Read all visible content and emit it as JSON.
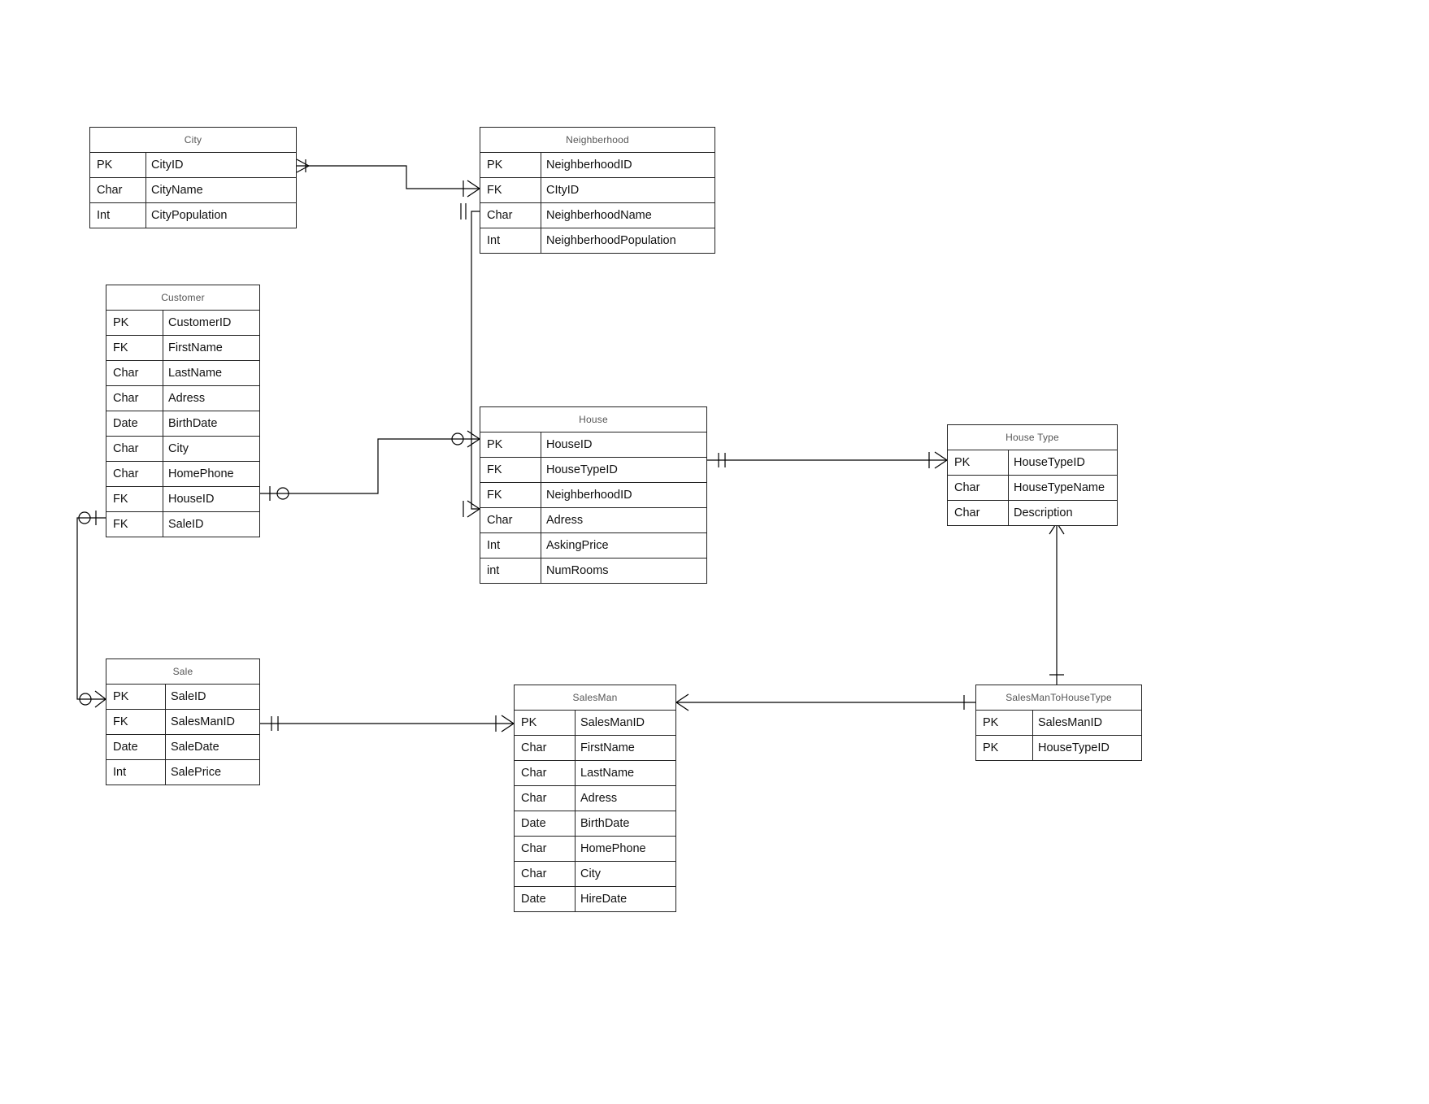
{
  "entities": {
    "city": {
      "title": "City",
      "rows": [
        {
          "k": "PK",
          "n": "CityID"
        },
        {
          "k": "Char",
          "n": "CityName"
        },
        {
          "k": "Int",
          "n": "CityPopulation"
        }
      ]
    },
    "neigh": {
      "title": "Neighberhood",
      "rows": [
        {
          "k": "PK",
          "n": "NeighberhoodID"
        },
        {
          "k": "FK",
          "n": "CItyID"
        },
        {
          "k": "Char",
          "n": "NeighberhoodName"
        },
        {
          "k": "Int",
          "n": "NeighberhoodPopulation"
        }
      ]
    },
    "cust": {
      "title": "Customer",
      "rows": [
        {
          "k": "PK",
          "n": "CustomerID"
        },
        {
          "k": "FK",
          "n": "FirstName"
        },
        {
          "k": "Char",
          "n": "LastName"
        },
        {
          "k": "Char",
          "n": "Adress"
        },
        {
          "k": "Date",
          "n": "BirthDate"
        },
        {
          "k": "Char",
          "n": "City"
        },
        {
          "k": "Char",
          "n": "HomePhone"
        },
        {
          "k": "FK",
          "n": "HouseID"
        },
        {
          "k": "FK",
          "n": "SaleID"
        }
      ]
    },
    "house": {
      "title": "House",
      "rows": [
        {
          "k": "PK",
          "n": "HouseID"
        },
        {
          "k": "FK",
          "n": "HouseTypeID"
        },
        {
          "k": "FK",
          "n": "NeighberhoodID"
        },
        {
          "k": "Char",
          "n": "Adress"
        },
        {
          "k": "Int",
          "n": "AskingPrice"
        },
        {
          "k": "int",
          "n": "NumRooms"
        }
      ]
    },
    "htype": {
      "title": "House Type",
      "rows": [
        {
          "k": "PK",
          "n": "HouseTypeID"
        },
        {
          "k": "Char",
          "n": "HouseTypeName"
        },
        {
          "k": "Char",
          "n": "Description"
        }
      ]
    },
    "sale": {
      "title": "Sale",
      "rows": [
        {
          "k": "PK",
          "n": "SaleID"
        },
        {
          "k": "FK",
          "n": "SalesManID"
        },
        {
          "k": "Date",
          "n": "SaleDate"
        },
        {
          "k": "Int",
          "n": "SalePrice"
        }
      ]
    },
    "sman": {
      "title": "SalesMan",
      "rows": [
        {
          "k": "PK",
          "n": "SalesManID"
        },
        {
          "k": "Char",
          "n": "FirstName"
        },
        {
          "k": "Char",
          "n": "LastName"
        },
        {
          "k": "Char",
          "n": "Adress"
        },
        {
          "k": "Date",
          "n": "BirthDate"
        },
        {
          "k": "Char",
          "n": "HomePhone"
        },
        {
          "k": "Char",
          "n": "City"
        },
        {
          "k": "Date",
          "n": "HireDate"
        }
      ]
    },
    "smht": {
      "title": "SalesManToHouseType",
      "rows": [
        {
          "k": "PK",
          "n": "SalesManID"
        },
        {
          "k": "PK",
          "n": "HouseTypeID"
        }
      ]
    }
  }
}
